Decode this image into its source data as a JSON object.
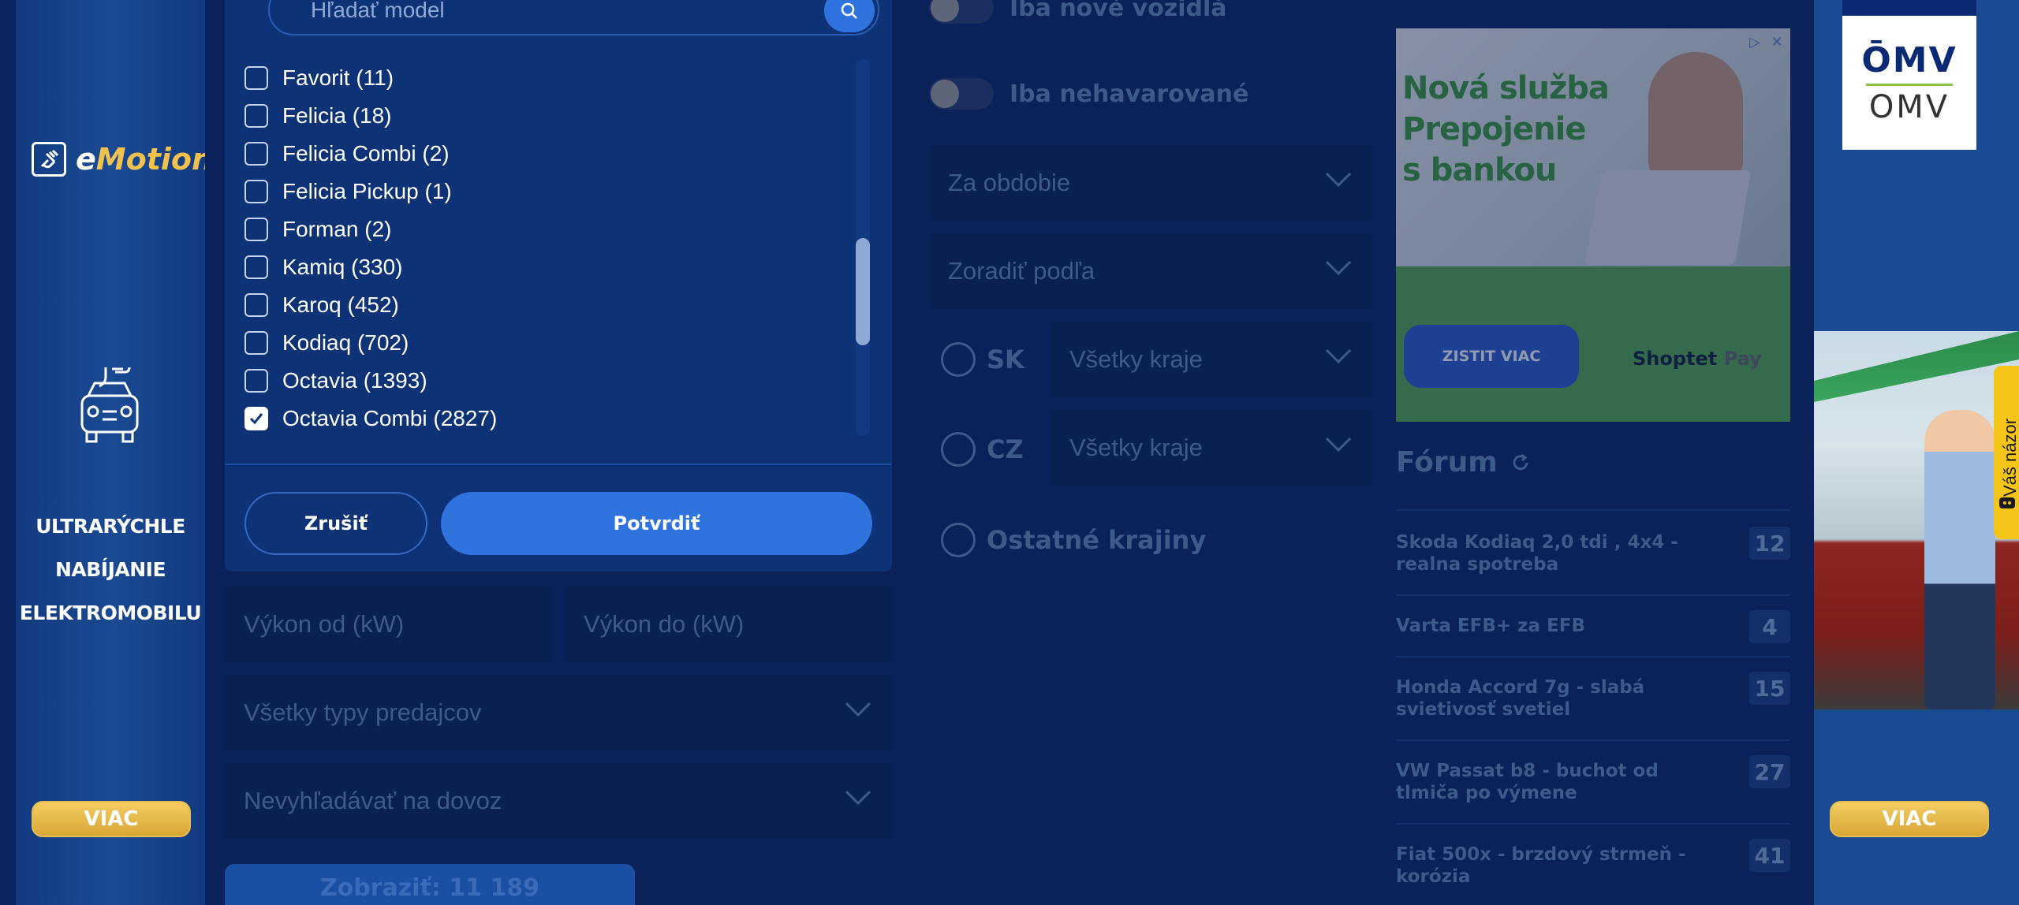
{
  "left_ad": {
    "brand": "eMotion",
    "brand_prefix": "e",
    "brand_rest": "Motion",
    "promo_lines": [
      "ULTRARÝCHLE",
      "NABÍJANIE",
      "ELEKTROMOBILU"
    ],
    "button": "VIAC"
  },
  "right_ad": {
    "brand": "OMV",
    "button": "VIAC"
  },
  "model_search": {
    "placeholder": "Hľadať model",
    "icon": "search-icon"
  },
  "models": [
    {
      "label": "Favorit (11)",
      "checked": false
    },
    {
      "label": "Felicia (18)",
      "checked": false
    },
    {
      "label": "Felicia Combi (2)",
      "checked": false
    },
    {
      "label": "Felicia Pickup (1)",
      "checked": false
    },
    {
      "label": "Forman (2)",
      "checked": false
    },
    {
      "label": "Kamiq (330)",
      "checked": false
    },
    {
      "label": "Karoq (452)",
      "checked": false
    },
    {
      "label": "Kodiaq (702)",
      "checked": false
    },
    {
      "label": "Octavia (1393)",
      "checked": false
    },
    {
      "label": "Octavia Combi (2827)",
      "checked": true
    }
  ],
  "panel_buttons": {
    "cancel": "Zrušiť",
    "confirm": "Potvrdiť"
  },
  "filters": {
    "power_from": "Výkon od (kW)",
    "power_to": "Výkon do (kW)",
    "seller_types": "Všetky typy predajcov",
    "import": "Nevyhľadávať na dovoz",
    "show_button": "Zobraziť: 11 189"
  },
  "middle": {
    "toggle_new": "Iba nové vozidlá",
    "toggle_undamaged": "Iba nehavarované",
    "period": "Za obdobie",
    "sort": "Zoradiť podľa",
    "country_sk": "SK",
    "country_cz": "CZ",
    "regions_sk": "Všetky kraje",
    "regions_cz": "Všetky kraje",
    "other_countries": "Ostatné krajiny"
  },
  "promo_ad": {
    "headline": [
      "Nová služba",
      "Prepojenie",
      "s bankou"
    ],
    "cta": "ZISTIT VIAC",
    "brand_main": "Shoptet",
    "brand_suffix": " Pay"
  },
  "forum": {
    "title": "Fórum",
    "refresh_icon": "refresh-icon",
    "threads": [
      {
        "title": "Skoda Kodiaq 2,0 tdi , 4x4 - realna spotreba",
        "count": "12"
      },
      {
        "title": "Varta EFB+ za EFB",
        "count": "4"
      },
      {
        "title": "Honda Accord 7g - slabá svietivosť svetiel",
        "count": "15"
      },
      {
        "title": "VW Passat b8 - buchot od tlmiča po výmene",
        "count": "27"
      },
      {
        "title": "Fiat 500x - brzdový strmeň - korózia",
        "count": "41"
      }
    ]
  },
  "feedback": {
    "label": "Váš názor"
  },
  "colors": {
    "page_bg": "#0b2159",
    "panel_bg": "#0e3276",
    "primary_button": "#2f74de",
    "ad_gold": "#e8bd4f",
    "feedback_tab": "#f5c518"
  }
}
